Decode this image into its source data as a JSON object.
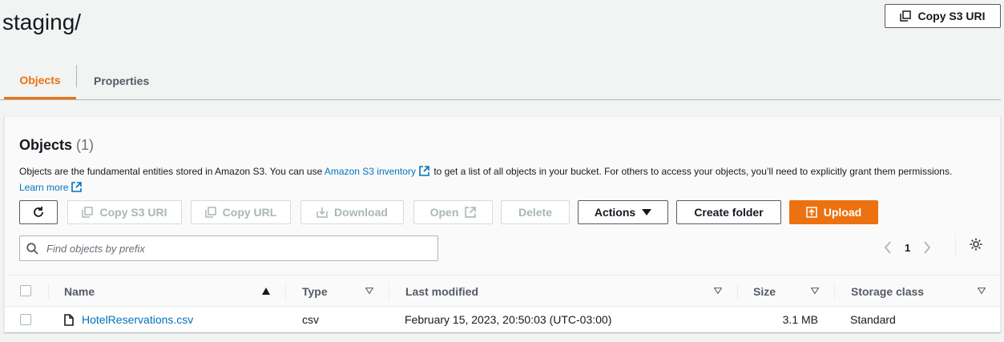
{
  "page": {
    "title": "staging/",
    "copy_s3_uri_label": "Copy S3 URI"
  },
  "tabs": [
    {
      "label": "Objects",
      "active": true
    },
    {
      "label": "Properties",
      "active": false
    }
  ],
  "objects_panel": {
    "title": "Objects",
    "count": "(1)",
    "description_before": "Objects are the fundamental entities stored in Amazon S3. You can use",
    "inventory_link": "Amazon S3 inventory",
    "description_after": "to get a list of all objects in your bucket. For others to access your objects, you’ll need to explicitly grant them permissions.",
    "learn_more": "Learn more"
  },
  "toolbar": {
    "refresh_icon": "refresh-icon",
    "copy_s3_uri": "Copy S3 URI",
    "copy_url": "Copy URL",
    "download": "Download",
    "open": "Open",
    "delete": "Delete",
    "actions": "Actions",
    "create_folder": "Create folder",
    "upload": "Upload"
  },
  "search": {
    "placeholder": "Find objects by prefix"
  },
  "pagination": {
    "current_page": "1"
  },
  "table": {
    "columns": [
      "Name",
      "Type",
      "Last modified",
      "Size",
      "Storage class"
    ],
    "rows": [
      {
        "name": "HotelReservations.csv",
        "type": "csv",
        "last_modified": "February 15, 2023, 20:50:03 (UTC-03:00)",
        "size": "3.1 MB",
        "storage_class": "Standard"
      }
    ]
  },
  "colors": {
    "accent": "#ec7211",
    "link": "#0073bb",
    "disabled": "#aab7b8"
  }
}
